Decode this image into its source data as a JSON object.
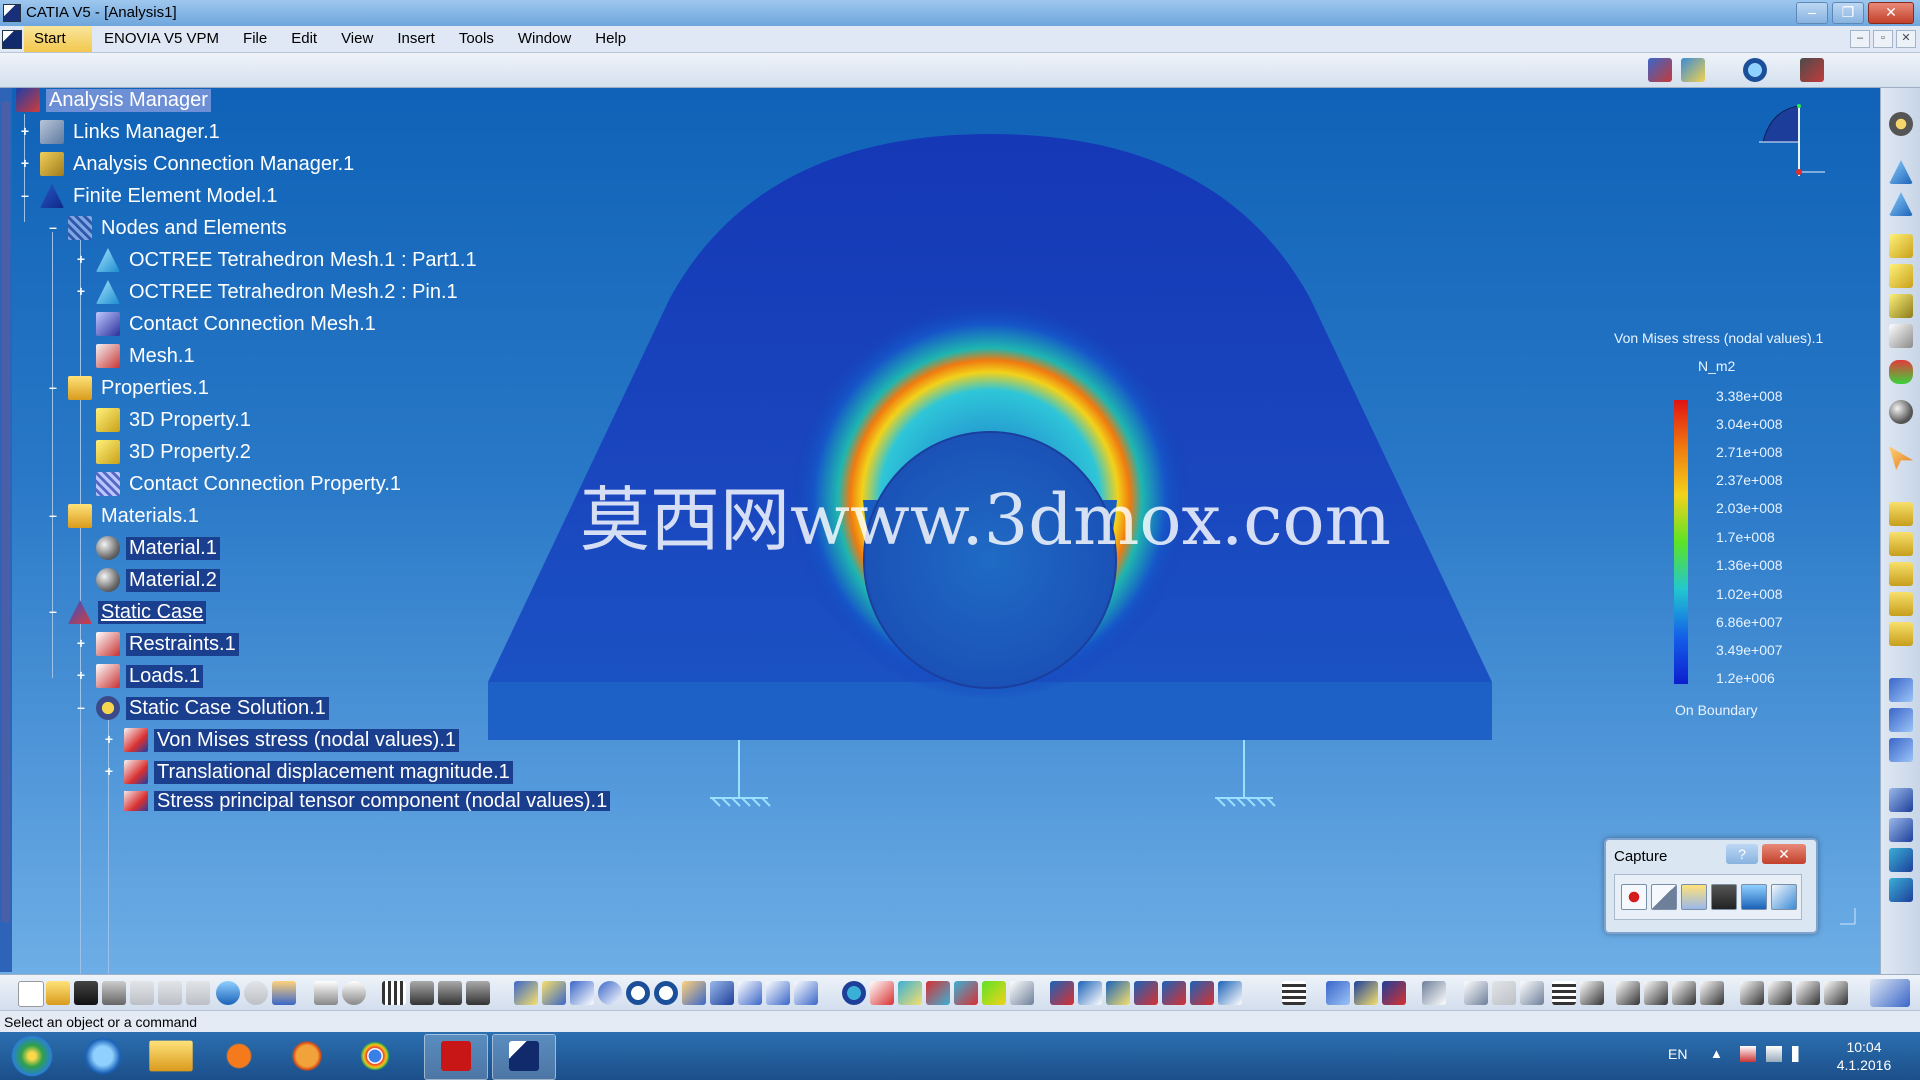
{
  "window": {
    "title": "CATIA V5 - [Analysis1]"
  },
  "menu": {
    "start": "Start",
    "items": [
      "ENOVIA V5 VPM",
      "File",
      "Edit",
      "View",
      "Insert",
      "Tools",
      "Window",
      "Help"
    ]
  },
  "tree": {
    "nodes": [
      {
        "label": "Analysis Manager",
        "icon": "analysis-manager-icon"
      },
      {
        "label": "Links Manager.1",
        "icon": "links-manager-icon"
      },
      {
        "label": "Analysis Connection Manager.1",
        "icon": "connection-manager-icon"
      },
      {
        "label": "Finite Element Model.1",
        "icon": "finite-element-model-icon"
      },
      {
        "label": "Nodes and Elements",
        "icon": "nodes-elements-icon"
      },
      {
        "label": "OCTREE Tetrahedron Mesh.1 : Part1.1",
        "icon": "tetra-mesh-icon"
      },
      {
        "label": "OCTREE Tetrahedron Mesh.2 : Pin.1",
        "icon": "tetra-mesh-icon"
      },
      {
        "label": "Contact Connection Mesh.1",
        "icon": "contact-mesh-icon"
      },
      {
        "label": "Mesh.1",
        "icon": "mesh-icon"
      },
      {
        "label": "Properties.1",
        "icon": "folder-icon"
      },
      {
        "label": "3D Property.1",
        "icon": "property-3d-icon"
      },
      {
        "label": "3D Property.2",
        "icon": "property-3d-icon"
      },
      {
        "label": "Contact Connection Property.1",
        "icon": "contact-property-icon"
      },
      {
        "label": "Materials.1",
        "icon": "folder-icon"
      },
      {
        "label": "Material.1",
        "icon": "material-sphere-icon"
      },
      {
        "label": "Material.2",
        "icon": "material-sphere-icon"
      },
      {
        "label": "Static Case",
        "icon": "static-case-icon"
      },
      {
        "label": "Restraints.1",
        "icon": "restraints-icon"
      },
      {
        "label": "Loads.1",
        "icon": "loads-icon"
      },
      {
        "label": "Static Case Solution.1",
        "icon": "solution-gear-icon"
      },
      {
        "label": "Von Mises stress (nodal values).1",
        "icon": "image-result-icon"
      },
      {
        "label": "Translational displacement magnitude.1",
        "icon": "image-result-icon"
      },
      {
        "label": "Stress principal tensor component (nodal values).1",
        "icon": "image-result-icon"
      }
    ]
  },
  "watermark": "莫西网www.3dmox.com",
  "legend": {
    "title": "Von Mises stress (nodal values).1",
    "unit": "N_m2",
    "values": [
      "3.38e+008",
      "3.04e+008",
      "2.71e+008",
      "2.37e+008",
      "2.03e+008",
      "1.7e+008",
      "1.36e+008",
      "1.02e+008",
      "6.86e+007",
      "3.49e+007",
      "1.2e+006"
    ],
    "footer": "On Boundary",
    "colors": [
      "#e01313",
      "#f07a10",
      "#f3d21a",
      "#5ce326",
      "#22c7cf",
      "#1460e8",
      "#0c1ed0"
    ]
  },
  "capture": {
    "title": "Capture",
    "help": "?",
    "close": "✕"
  },
  "status": {
    "message": "Select an object or a command"
  },
  "taskbar": {
    "language": "EN",
    "time": "10:04",
    "date": "4.1.2016",
    "apps": [
      "windows-start-icon",
      "internet-explorer-icon",
      "file-explorer-icon",
      "media-player-icon",
      "firefox-icon",
      "chrome-icon",
      "acrobat-icon",
      "catia-icon"
    ]
  },
  "colors": {
    "selection": "#6d8fd6",
    "tree_highlight": "#1a3f8e",
    "background_top": "#0f62b7"
  }
}
